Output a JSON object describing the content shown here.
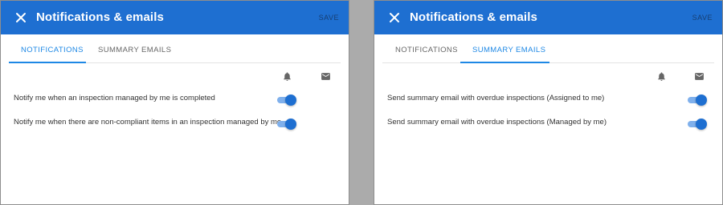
{
  "left": {
    "title": "Notifications & emails",
    "save_label": "SAVE",
    "tabs": [
      {
        "label": "NOTIFICATIONS",
        "active": true
      },
      {
        "label": "SUMMARY EMAILS",
        "active": false
      }
    ],
    "column_icons": [
      "bell-icon",
      "mail-icon"
    ],
    "rows": [
      {
        "label": "Notify me when an inspection managed by me is completed",
        "enabled": true
      },
      {
        "label": "Notify me when there are non-compliant items in an inspection managed by me",
        "enabled": true
      }
    ]
  },
  "right": {
    "title": "Notifications & emails",
    "save_label": "SAVE",
    "tabs": [
      {
        "label": "NOTIFICATIONS",
        "active": false
      },
      {
        "label": "SUMMARY EMAILS",
        "active": true
      }
    ],
    "column_icons": [
      "bell-icon",
      "mail-icon"
    ],
    "rows": [
      {
        "label": "Send summary email with overdue inspections (Assigned to me)",
        "enabled": true
      },
      {
        "label": "Send summary email with overdue inspections (Managed by me)",
        "enabled": true
      }
    ]
  },
  "colors": {
    "header": "#1e6fd1",
    "accent": "#1e88e5",
    "toggle_track": "#7fb0ec",
    "toggle_thumb": "#1e6fd1",
    "background_gap": "#ababab"
  }
}
